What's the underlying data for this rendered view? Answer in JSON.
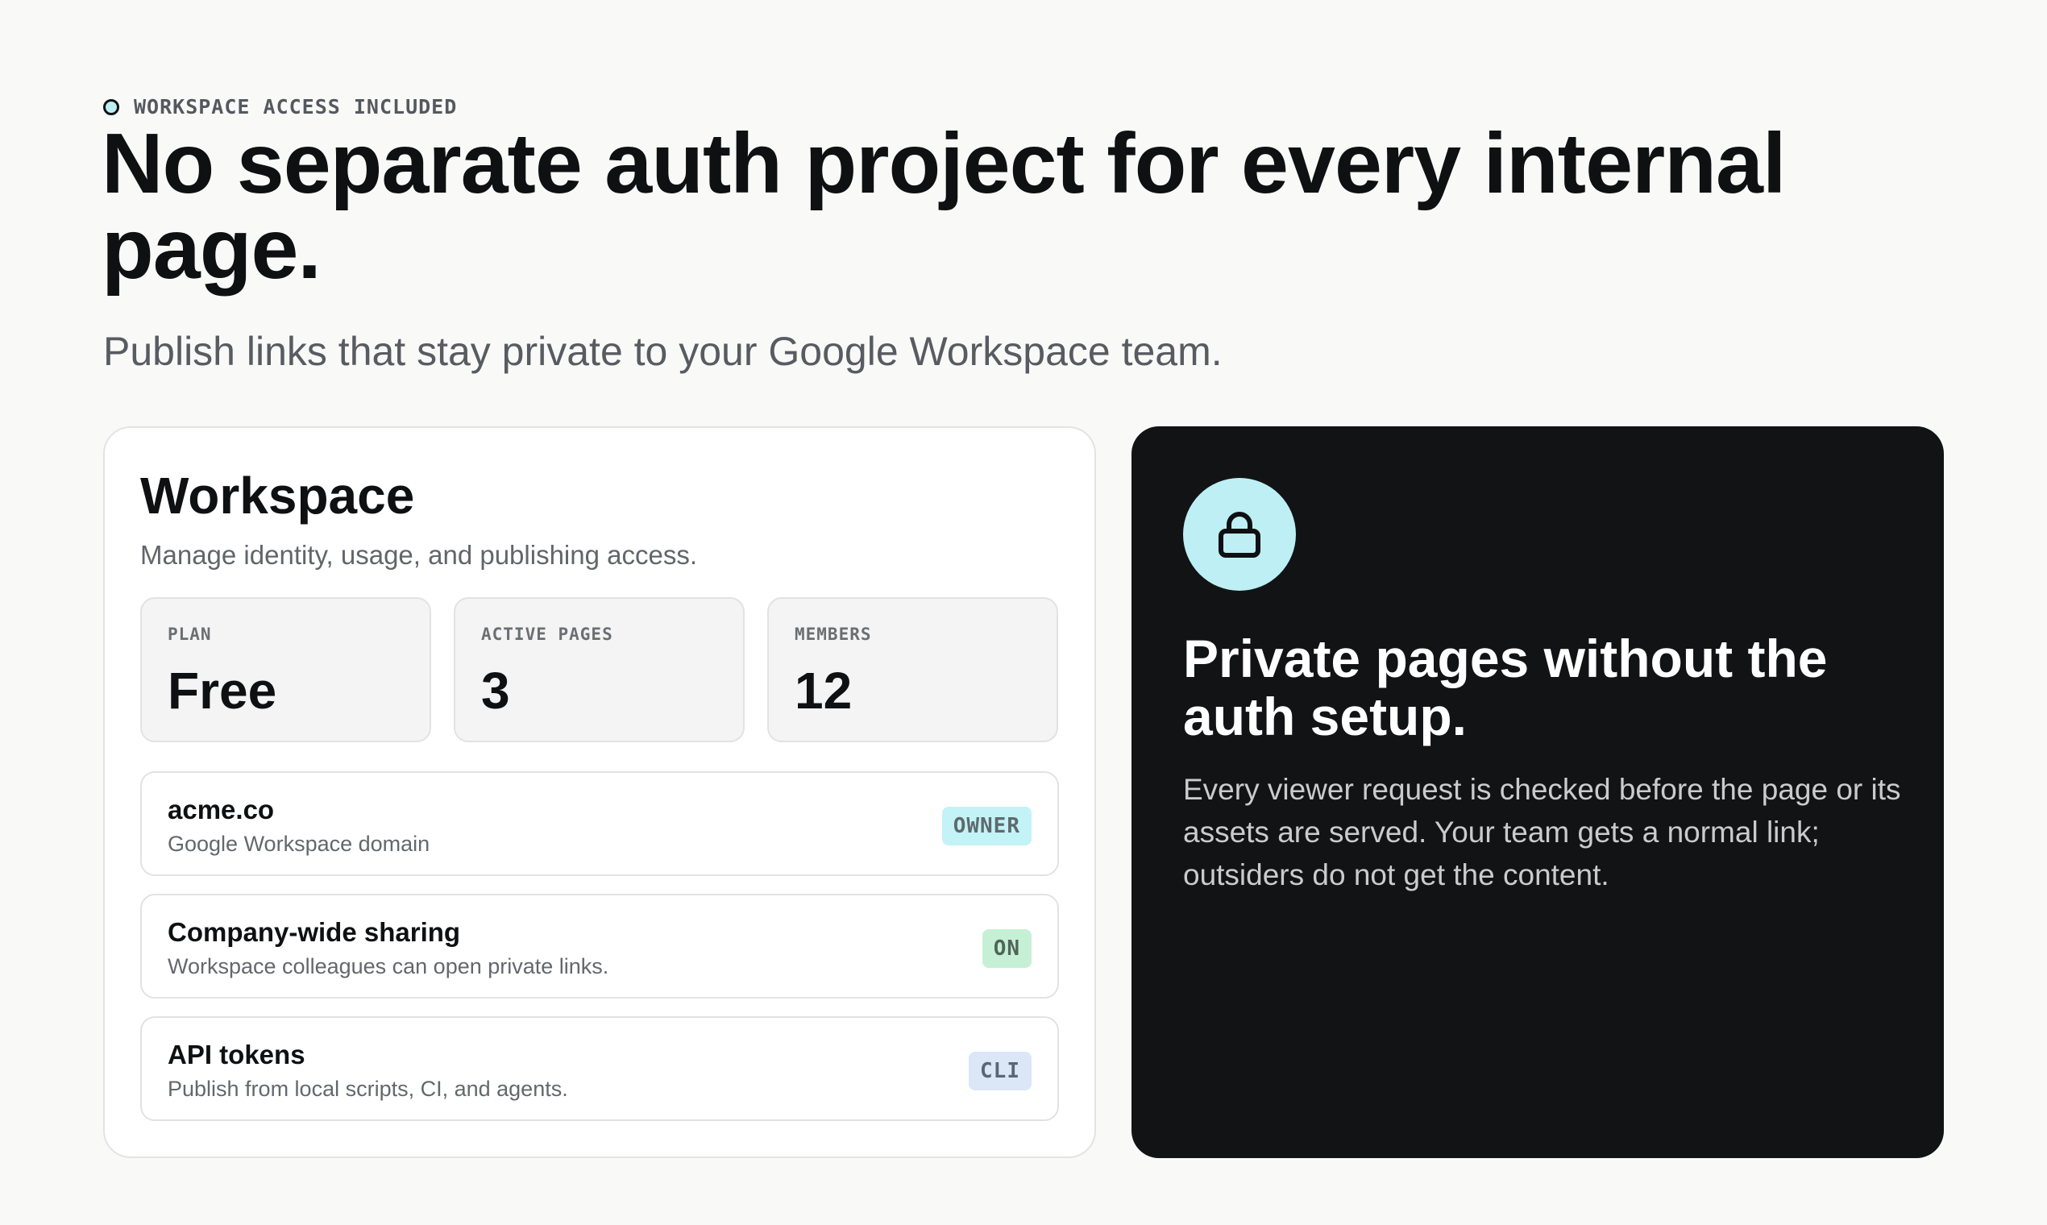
{
  "hero": {
    "eyebrow": "WORKSPACE ACCESS INCLUDED",
    "headline": "No separate auth project for every internal page.",
    "subhead": "Publish links that stay private to your Google Workspace team."
  },
  "workspace": {
    "title": "Workspace",
    "subtitle": "Manage identity, usage, and publishing access.",
    "stats": [
      {
        "label": "PLAN",
        "value": "Free"
      },
      {
        "label": "ACTIVE PAGES",
        "value": "3"
      },
      {
        "label": "MEMBERS",
        "value": "12"
      }
    ],
    "rows": [
      {
        "title": "acme.co",
        "description": "Google Workspace domain",
        "badge": "OWNER",
        "badge_bg": "#c3f3f6",
        "badge_color": "#5e6a6e"
      },
      {
        "title": "Company-wide sharing",
        "description": "Workspace colleagues can open private links.",
        "badge": "ON",
        "badge_bg": "#c6f0d6",
        "badge_color": "#4f6659"
      },
      {
        "title": "API tokens",
        "description": "Publish from local scripts, CI, and agents.",
        "badge": "CLI",
        "badge_bg": "#dbe6f6",
        "badge_color": "#5a6575"
      }
    ]
  },
  "feature": {
    "icon": "lock-icon",
    "title": "Private pages without the auth setup.",
    "body": "Every viewer request is checked before the page or its assets are served. Your team gets a normal link; outsiders do not get the content."
  },
  "colors": {
    "page_bg": "#f9f9f8",
    "accent": "#bdeff4",
    "dark_card": "#121315"
  }
}
